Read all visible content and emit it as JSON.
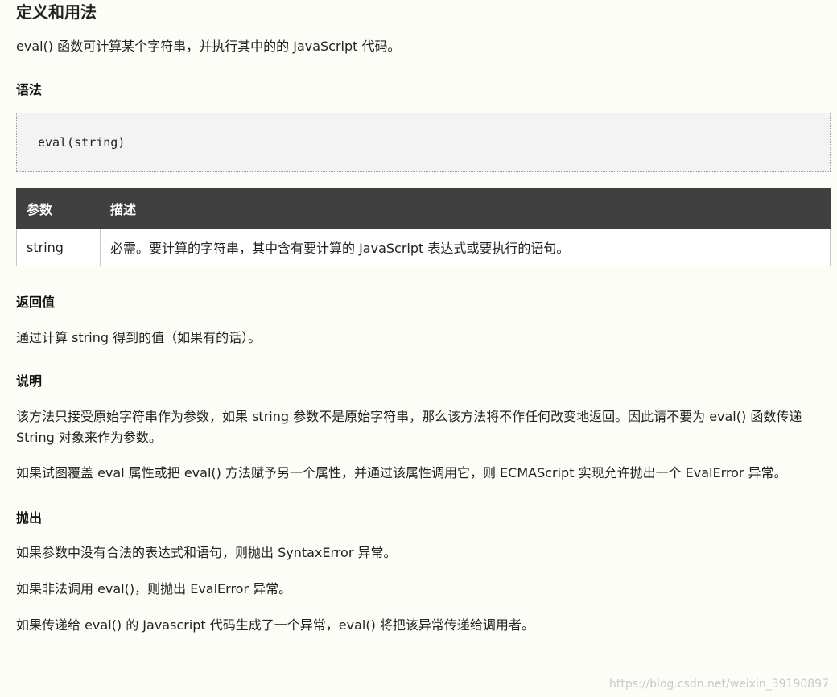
{
  "title": "定义和用法",
  "intro": "eval() 函数可计算某个字符串，并执行其中的的 JavaScript 代码。",
  "syntax": {
    "heading": "语法",
    "code": "eval(string)"
  },
  "params_table": {
    "headers": [
      "参数",
      "描述"
    ],
    "rows": [
      {
        "param": "string",
        "desc": "必需。要计算的字符串，其中含有要计算的 JavaScript 表达式或要执行的语句。"
      }
    ]
  },
  "return_value": {
    "heading": "返回值",
    "text": "通过计算 string 得到的值（如果有的话）。"
  },
  "description": {
    "heading": "说明",
    "p1": "该方法只接受原始字符串作为参数，如果 string 参数不是原始字符串，那么该方法将不作任何改变地返回。因此请不要为 eval() 函数传递 String 对象来作为参数。",
    "p2": "如果试图覆盖 eval 属性或把 eval() 方法赋予另一个属性，并通过该属性调用它，则 ECMAScript 实现允许抛出一个 EvalError 异常。"
  },
  "throws": {
    "heading": "抛出",
    "p1": "如果参数中没有合法的表达式和语句，则抛出 SyntaxError 异常。",
    "p2": "如果非法调用 eval()，则抛出 EvalError 异常。",
    "p3": "如果传递给 eval() 的 Javascript 代码生成了一个异常，eval() 将把该异常传递给调用者。"
  },
  "watermark": "https://blog.csdn.net/weixin_39190897"
}
